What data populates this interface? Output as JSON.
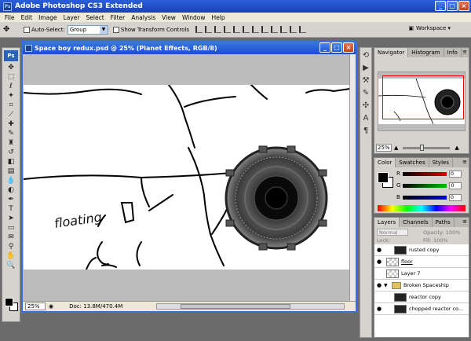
{
  "app": {
    "title": "Adobe Photoshop CS3 Extended",
    "ps_badge": "Ps"
  },
  "window_buttons": {
    "min": "_",
    "max": "□",
    "close": "×"
  },
  "menu": [
    "File",
    "Edit",
    "Image",
    "Layer",
    "Select",
    "Filter",
    "Analysis",
    "View",
    "Window",
    "Help"
  ],
  "options": {
    "auto_select_label": "Auto-Select:",
    "auto_select_value": "Group",
    "show_transform_label": "Show Transform Controls",
    "workspace_label": "Workspace ▾"
  },
  "document": {
    "title": "Space boy redux.psd @ 25% (Planet Effects, RGB/8)",
    "zoom": "25%",
    "doc_info": "Doc: 13.8M/470.4M"
  },
  "navigator": {
    "tabs": [
      "Navigator",
      "Histogram",
      "Info"
    ],
    "zoom": "25%"
  },
  "color_panel": {
    "tabs": [
      "Color",
      "Swatches",
      "Styles"
    ],
    "channels": [
      {
        "label": "R",
        "value": "0",
        "color": "#e00000"
      },
      {
        "label": "G",
        "value": "0",
        "color": "#00a000"
      },
      {
        "label": "B",
        "value": "0",
        "color": "#0000e0"
      }
    ]
  },
  "layers_panel": {
    "tabs": [
      "Layers",
      "Channels",
      "Paths"
    ],
    "blend_mode": "Normal",
    "opacity_label": "Opacity:",
    "opacity_value": "100%",
    "lock_label": "Lock:",
    "fill_label": "Fill:",
    "fill_value": "100%",
    "rows": [
      {
        "name": "rusted copy",
        "visible": true,
        "kind": "dark",
        "indent": true
      },
      {
        "name": "floor",
        "visible": true,
        "kind": "checker",
        "indent": false,
        "underline": true
      },
      {
        "name": "Layer 7",
        "visible": false,
        "kind": "checker",
        "indent": false
      },
      {
        "name": "Broken Spaceship",
        "visible": true,
        "kind": "folder",
        "indent": false
      },
      {
        "name": "reactor copy",
        "visible": false,
        "kind": "dark",
        "indent": true
      },
      {
        "name": "chopped reactor co...",
        "visible": true,
        "kind": "dark",
        "indent": true
      }
    ]
  }
}
